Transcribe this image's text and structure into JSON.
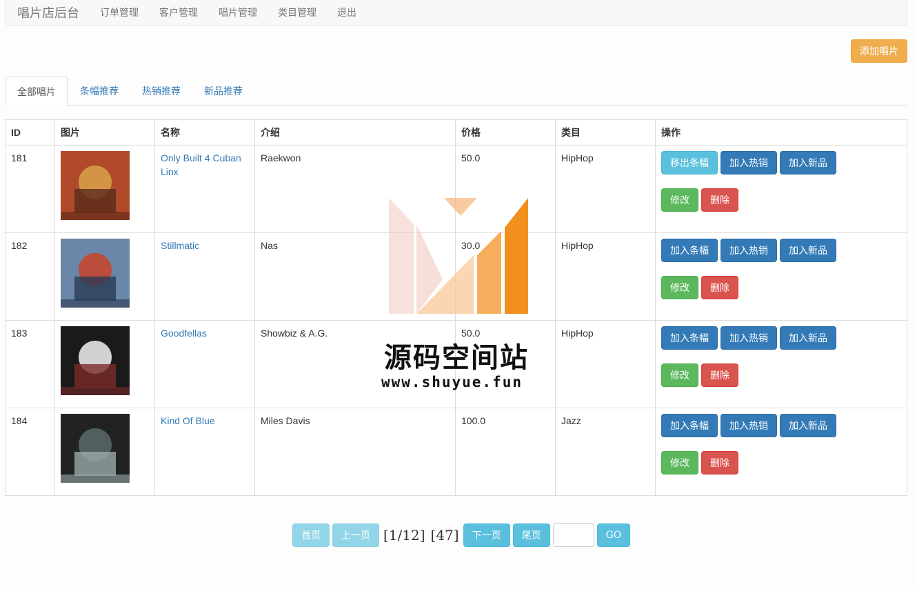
{
  "navbar": {
    "brand": "唱片店后台",
    "links": [
      "订单管理",
      "客户管理",
      "唱片管理",
      "类目管理",
      "退出"
    ]
  },
  "add_button": "添加唱片",
  "tabs": [
    {
      "label": "全部唱片",
      "active": true
    },
    {
      "label": "条幅推荐",
      "active": false
    },
    {
      "label": "热销推荐",
      "active": false
    },
    {
      "label": "新品推荐",
      "active": false
    }
  ],
  "table": {
    "headers": [
      "ID",
      "图片",
      "名称",
      "介绍",
      "价格",
      "类目",
      "操作"
    ],
    "rows": [
      {
        "id": "181",
        "name": "Only Built 4 Cuban Linx",
        "intro": "Raekwon",
        "price": "50.0",
        "category": "HipHop",
        "actions": [
          "移出条幅",
          "加入热销",
          "加入新品",
          "修改",
          "删除"
        ],
        "cover_colors": [
          "#b04a2a",
          "#d9a24a",
          "#5a2a1a"
        ]
      },
      {
        "id": "182",
        "name": "Stillmatic",
        "intro": "Nas",
        "price": "30.0",
        "category": "HipHop",
        "actions": [
          "加入条幅",
          "加入热销",
          "加入新品",
          "修改",
          "删除"
        ],
        "cover_colors": [
          "#6a86a8",
          "#c9432a",
          "#2b3b54"
        ]
      },
      {
        "id": "183",
        "name": "Goodfellas",
        "intro": "Showbiz & A.G.",
        "price": "50.0",
        "category": "HipHop",
        "actions": [
          "加入条幅",
          "加入热销",
          "加入新品",
          "修改",
          "删除"
        ],
        "cover_colors": [
          "#1a1a1a",
          "#f2f2f2",
          "#7a2a2a"
        ]
      },
      {
        "id": "184",
        "name": "Kind Of Blue",
        "intro": "Miles Davis",
        "price": "100.0",
        "category": "Jazz",
        "actions": [
          "加入条幅",
          "加入热销",
          "加入新品",
          "修改",
          "删除"
        ],
        "cover_colors": [
          "#222",
          "#5a6a6a",
          "#9aa"
        ]
      }
    ]
  },
  "pager": {
    "first": "首页",
    "prev": "上一页",
    "page_info": "[1/12]",
    "total_info": "[47]",
    "next": "下一页",
    "last": "尾页",
    "go": "GO"
  },
  "watermark": {
    "text": "源码空间站",
    "url": "www.shuyue.fun"
  }
}
